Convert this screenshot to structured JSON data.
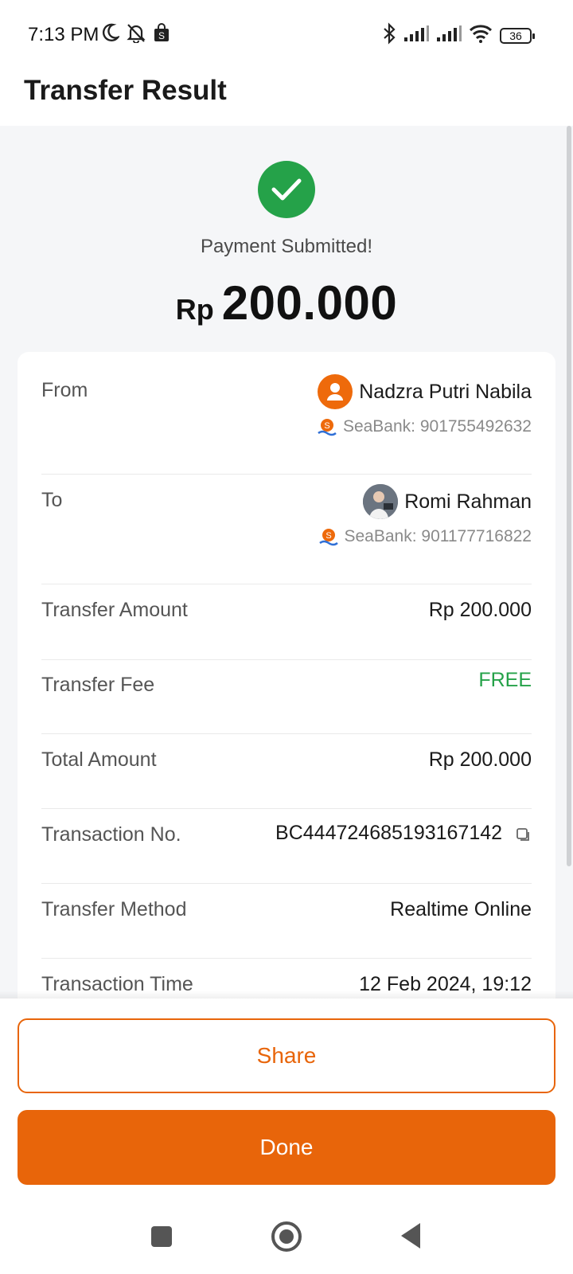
{
  "status_bar": {
    "time": "7:13 PM",
    "battery": "36",
    "icons": [
      "moon-icon",
      "bell-off-icon",
      "shop-icon",
      "bluetooth-icon",
      "signal-icon",
      "signal-icon",
      "wifi-icon",
      "battery-icon"
    ]
  },
  "header": {
    "title": "Transfer Result"
  },
  "result": {
    "status": "Payment Submitted!",
    "currency": "Rp",
    "amount": "200.000",
    "accent_color": "#25a249"
  },
  "details": {
    "from": {
      "label": "From",
      "name": "Nadzra Putri Nabila",
      "bank": "SeaBank: 901755492632"
    },
    "to": {
      "label": "To",
      "name": "Romi Rahman",
      "bank": "SeaBank: 901177716822"
    },
    "transfer_amount": {
      "label": "Transfer Amount",
      "value": "Rp 200.000"
    },
    "transfer_fee": {
      "label": "Transfer Fee",
      "value": "FREE"
    },
    "total_amount": {
      "label": "Total Amount",
      "value": "Rp 200.000"
    },
    "transaction_no": {
      "label": "Transaction No.",
      "value": "BC444724685193167142"
    },
    "transfer_method": {
      "label": "Transfer Method",
      "value": "Realtime Online"
    },
    "transaction_time": {
      "label": "Transaction Time",
      "value": "12 Feb 2024, 19:12"
    }
  },
  "actions": {
    "share": "Share",
    "done": "Done",
    "brand_color": "#e8650a"
  }
}
